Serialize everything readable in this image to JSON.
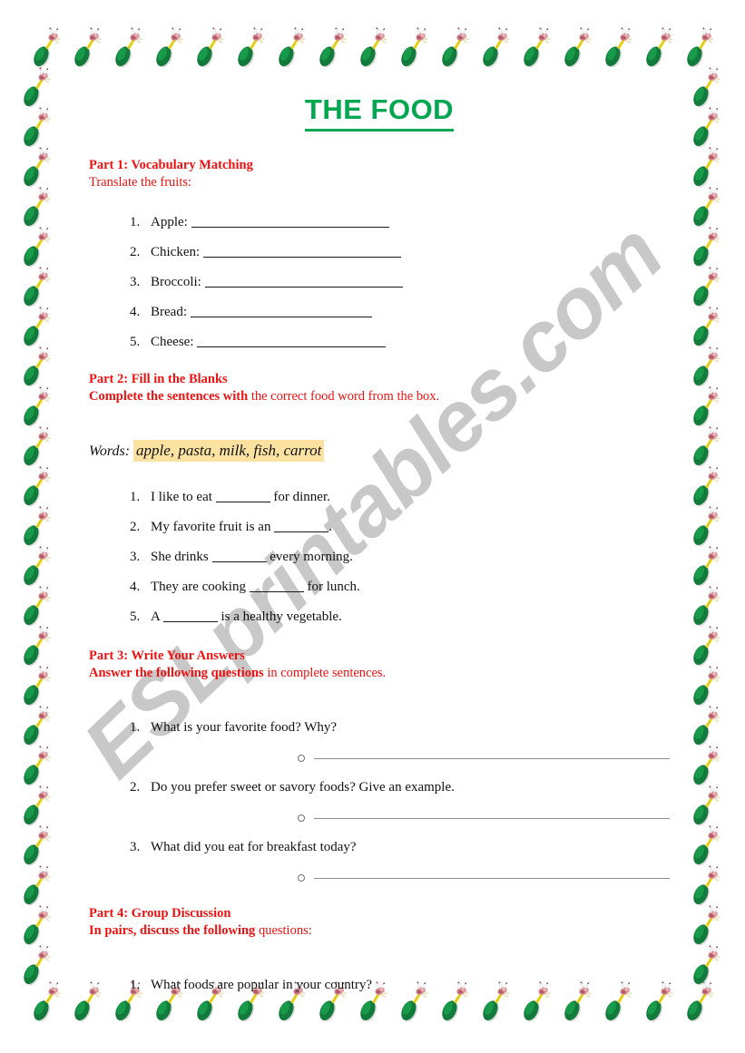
{
  "document": {
    "title": "THE FOOD",
    "watermark": "ESLprintables.com",
    "title_color": "#00a650",
    "heading_color": "#ee1111",
    "highlight_color": "#fbe2a0",
    "border_motif": "avocado-flower-clipart"
  },
  "part1": {
    "heading": "Part 1: Vocabulary Matching",
    "instruction": "Translate the fruits:",
    "items": [
      {
        "label": "Apple:",
        "blank_width": 218
      },
      {
        "label": "Chicken:",
        "blank_width": 218
      },
      {
        "label": "Broccoli:",
        "blank_width": 218
      },
      {
        "label": "Bread:",
        "blank_width": 200
      },
      {
        "label": "Cheese:",
        "blank_width": 208
      }
    ]
  },
  "part2": {
    "heading": "Part 2: Fill in the Blanks",
    "instruction_bold": "Complete the sentences with",
    "instruction_rest": " the correct food word from the box.",
    "words_label": "Words:",
    "words_value": "apple, pasta, milk, fish, carrot",
    "sentences": [
      {
        "before": "I like to eat ",
        "after": " for dinner."
      },
      {
        "before": "My favorite fruit is an ",
        "after": "."
      },
      {
        "before": "She drinks ",
        "after": " every morning."
      },
      {
        "before": "They are cooking ",
        "after": " for lunch."
      },
      {
        "before": "A ",
        "after": " is a healthy vegetable."
      }
    ]
  },
  "part3": {
    "heading": "Part 3: Write Your Answers",
    "instruction_bold": "Answer the following questions",
    "instruction_rest": " in complete sentences.",
    "questions": [
      "What is your favorite food? Why?",
      "Do you prefer sweet or savory foods? Give an example.",
      "What did you eat for breakfast today?"
    ]
  },
  "part4": {
    "heading": "Part 4: Group Discussion",
    "instruction_bold": "In pairs, discuss the following",
    "instruction_rest": " questions:",
    "questions": [
      "What foods are popular in your country?"
    ]
  }
}
